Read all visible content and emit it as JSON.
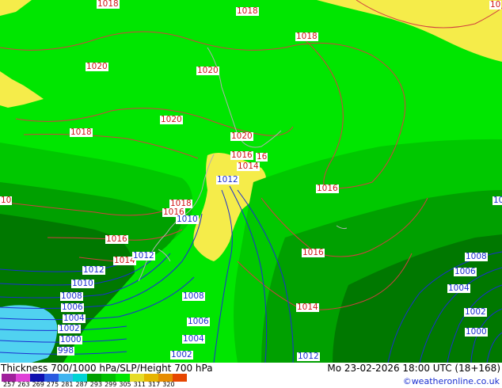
{
  "title": "Thickness 700/1000 hPa/SLP/Height 700 hPa",
  "datetime": "Mo 23-02-2026 18:00 UTC (18+168)",
  "credit": "©weatheronline.co.uk",
  "colors": {
    "band_warm": "#00e600",
    "band_mid": "#00c800",
    "band_cool": "#00a000",
    "band_cold": "#007800",
    "yellow": "#f5ec4a",
    "cyan": "#50d2f0",
    "slp_contour": "#d04040",
    "height_contour": "#1a2fd0"
  },
  "legend": {
    "colors": [
      "#a0209c",
      "#e040d8",
      "#1010b0",
      "#2a5ae0",
      "#40b4f0",
      "#00d4d4",
      "#00a000",
      "#00c000",
      "#00e600",
      "#e6dc28",
      "#e6b400",
      "#e68c00",
      "#e64600"
    ],
    "ticks": [
      "257",
      "263",
      "269",
      "275",
      "281",
      "287",
      "293",
      "299",
      "305",
      "311",
      "317",
      "320"
    ]
  },
  "slp_labels": [
    "1018",
    "1018",
    "1018",
    "1020",
    "1020",
    "1020",
    "1018",
    "1020",
    "1016",
    "1016",
    "1014",
    "1012",
    "1018",
    "1016",
    "1010",
    "1016",
    "1016",
    "1014",
    "1014",
    "10",
    "10",
    "16",
    "1012"
  ],
  "height_labels": [
    "1012",
    "1010",
    "1008",
    "1006",
    "1004",
    "1002",
    "1000",
    "998",
    "1008",
    "1006",
    "1004",
    "1002",
    "1012",
    "1008",
    "1006",
    "1004",
    "1002",
    "1000",
    "10"
  ]
}
